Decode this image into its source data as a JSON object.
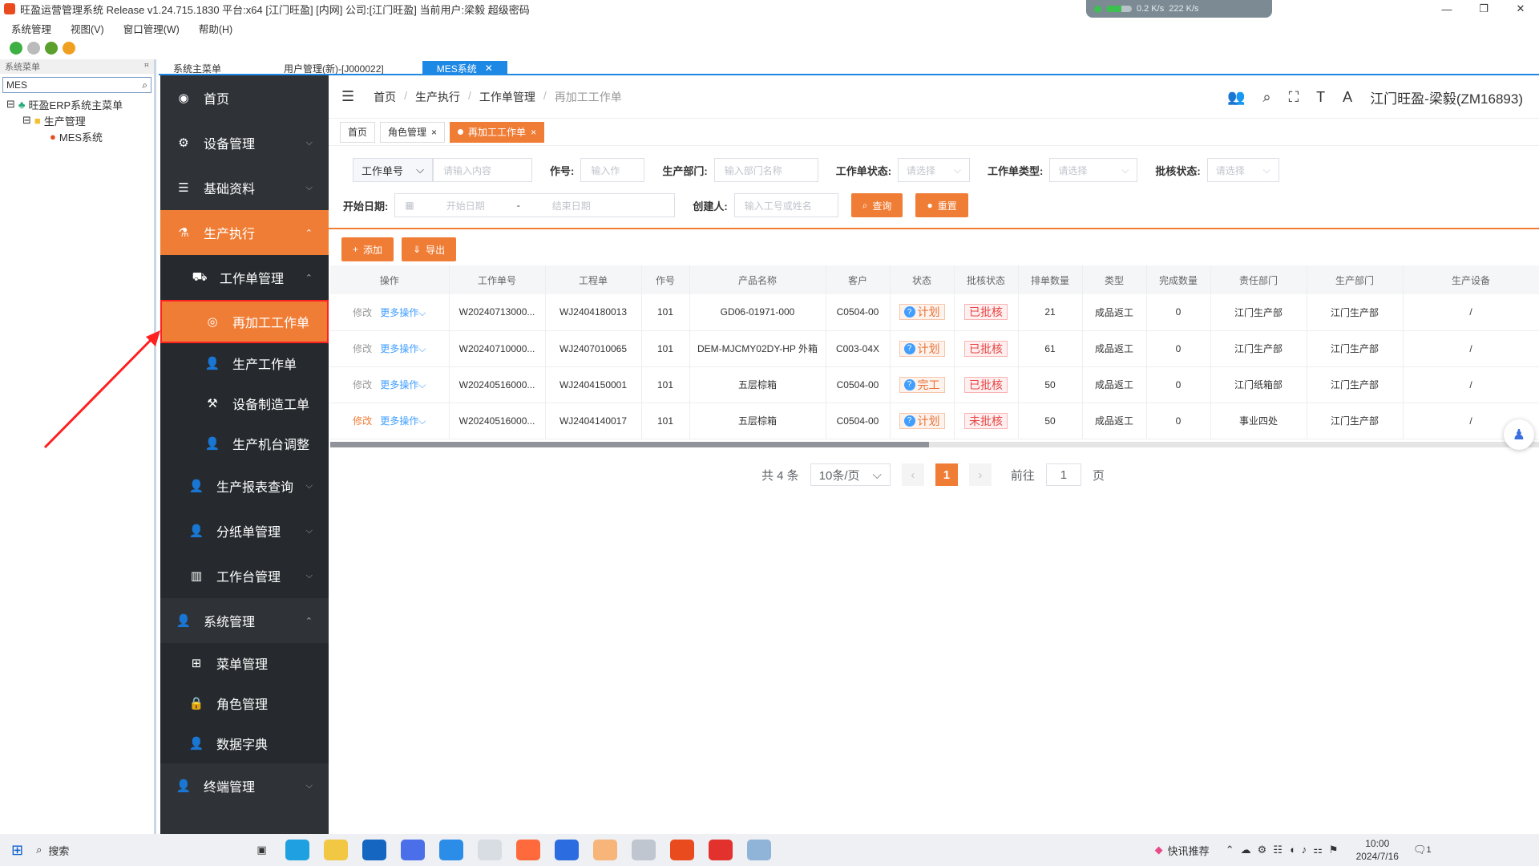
{
  "window": {
    "title": "旺盈运营管理系统 Release v1.24.715.1830 平台:x64 [江门旺盈] [内网] 公司:[江门旺盈] 当前用户:梁毅   超级密码",
    "net_up": "0.2 K/s",
    "net_down": "222 K/s",
    "minimize": "—",
    "restore": "❐",
    "close": "✕"
  },
  "menubar": [
    "系统管理",
    "视图(V)",
    "窗口管理(W)",
    "帮助(H)"
  ],
  "left_pane": {
    "header": "系统菜单",
    "pin": "ꟸ",
    "search_value": "MES",
    "tree": [
      "旺盈ERP系统主菜单",
      "生产管理",
      "MES系统"
    ]
  },
  "doc_tabs": [
    "系统主菜单",
    "用户管理(新)-[J000022]",
    "MES系统"
  ],
  "sidebar": {
    "items": [
      {
        "label": "首页",
        "icon": "palette-icon"
      },
      {
        "label": "设备管理",
        "icon": "gear-icon"
      },
      {
        "label": "基础资料",
        "icon": "list-icon"
      },
      {
        "label": "生产执行",
        "icon": "flask-icon"
      },
      {
        "label": "工作单管理",
        "icon": "truck-icon"
      },
      {
        "label": "再加工工作单",
        "icon": "chrome-icon"
      },
      {
        "label": "生产工作单",
        "icon": "user-icon"
      },
      {
        "label": "设备制造工单",
        "icon": "wrench-icon"
      },
      {
        "label": "生产机台调整",
        "icon": "user-icon"
      },
      {
        "label": "生产报表查询",
        "icon": "user-icon"
      },
      {
        "label": "分纸单管理",
        "icon": "user-icon"
      },
      {
        "label": "工作台管理",
        "icon": "bars-icon"
      },
      {
        "label": "系统管理",
        "icon": "user-icon"
      },
      {
        "label": "菜单管理",
        "icon": "sitemap-icon"
      },
      {
        "label": "角色管理",
        "icon": "lock-icon"
      },
      {
        "label": "数据字典",
        "icon": "user-icon"
      },
      {
        "label": "终端管理",
        "icon": "user-icon"
      }
    ]
  },
  "topnav": {
    "breadcrumb": [
      "首页",
      "生产执行",
      "工作单管理",
      "再加工工作单"
    ],
    "user": "江门旺盈-梁毅(ZM16893)"
  },
  "tags": [
    "首页",
    "角色管理",
    "再加工工作单"
  ],
  "filters": {
    "work_order_select": "工作单号",
    "work_order_placeholder": "请输入内容",
    "job_label": "作号:",
    "job_placeholder": "输入作",
    "dept_label": "生产部门:",
    "dept_placeholder": "输入部门名称",
    "status_label": "工作单状态:",
    "status_placeholder": "请选择",
    "type_label": "工作单类型:",
    "type_placeholder": "请选择",
    "approve_label": "批核状态:",
    "approve_placeholder": "请选择",
    "date_label": "开始日期:",
    "start_placeholder": "开始日期",
    "date_sep": "-",
    "end_placeholder": "结束日期",
    "creator_label": "创建人:",
    "creator_placeholder": "输入工号或姓名",
    "query": "查询",
    "reset": "重置"
  },
  "actions": {
    "add": "添加",
    "export": "导出"
  },
  "table": {
    "headers": [
      "操作",
      "工作单号",
      "工程单",
      "作号",
      "产品名称",
      "客户",
      "状态",
      "批核状态",
      "排单数量",
      "类型",
      "完成数量",
      "责任部门",
      "生产部门",
      "生产设备"
    ],
    "edit": "修改",
    "more": "更多操作",
    "rows": [
      {
        "wo": "W20240713000...",
        "eng": "WJ2404180013",
        "job": "101",
        "product": "GD06-01971-000",
        "cust": "C0504-00",
        "status": "计划",
        "approve": "已批核",
        "qty": "21",
        "type": "成品返工",
        "done": "0",
        "resp": "江门生产部",
        "prod": "江门生产部",
        "dev": "/"
      },
      {
        "wo": "W20240710000...",
        "eng": "WJ2407010065",
        "job": "101",
        "product": "DEM-MJCMY02DY-HP 外箱",
        "cust": "C003-04X",
        "status": "计划",
        "approve": "已批核",
        "qty": "61",
        "type": "成品返工",
        "done": "0",
        "resp": "江门生产部",
        "prod": "江门生产部",
        "dev": "/"
      },
      {
        "wo": "W20240516000...",
        "eng": "WJ2404150001",
        "job": "101",
        "product": "五层棕箱",
        "cust": "C0504-00",
        "status": "完工",
        "approve": "已批核",
        "qty": "50",
        "type": "成品返工",
        "done": "0",
        "resp": "江门纸箱部",
        "prod": "江门生产部",
        "dev": "/"
      },
      {
        "wo": "W20240516000...",
        "eng": "WJ2404140017",
        "job": "101",
        "product": "五层棕箱",
        "cust": "C0504-00",
        "status": "计划",
        "approve": "未批核",
        "qty": "50",
        "type": "成品返工",
        "done": "0",
        "resp": "事业四处",
        "prod": "江门生产部",
        "dev": "/"
      }
    ]
  },
  "pager": {
    "total": "共 4 条",
    "size": "10条/页",
    "page": "1",
    "goto": "前往",
    "goto_value": "1",
    "page_unit": "页"
  },
  "taskbar": {
    "search": "搜索",
    "news": "快讯推荐",
    "time": "10:00",
    "date": "2024/7/16",
    "notif": "1"
  },
  "colors": {
    "accent": "#f07d36",
    "sidebar": "#2f3338",
    "link": "#409eff",
    "highlight": "#ff2020"
  }
}
